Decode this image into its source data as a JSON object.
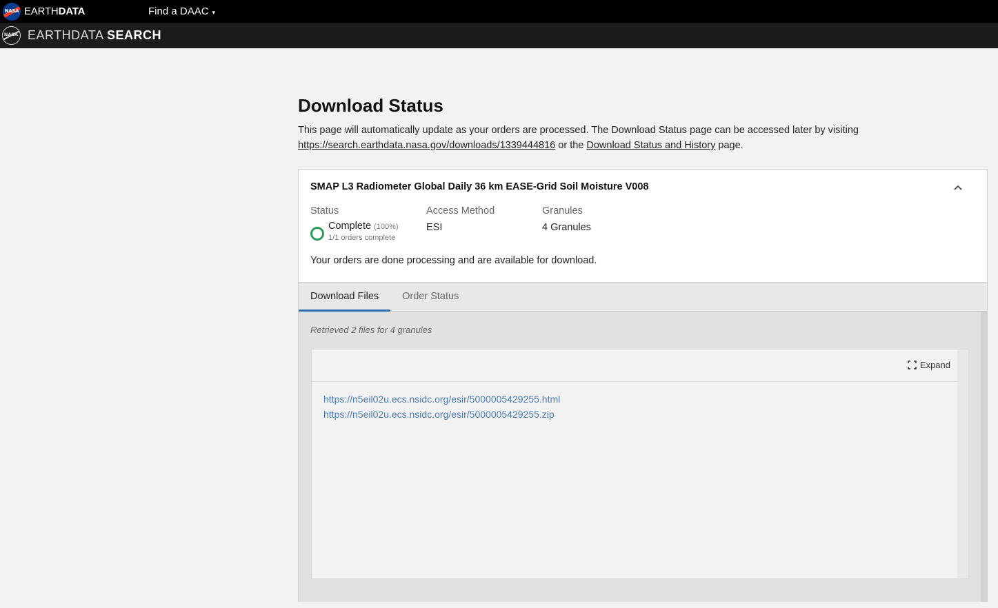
{
  "topbar": {
    "brand_light": "EARTH",
    "brand_bold": "DATA",
    "nasa_label": "NASA",
    "daac_menu": "Find a DAAC",
    "daac_caret": "▾"
  },
  "appbar": {
    "title_light": "EARTHDATA ",
    "title_bold": "SEARCH",
    "logo_label": "NASA"
  },
  "page": {
    "title": "Download Status",
    "intro_text": "This page will automatically update as your orders are processed. The Download Status page can be accessed later by visiting",
    "intro_link": "https://search.earthdata.nasa.gov/downloads/1339444816",
    "intro_mid": " or the ",
    "history_link": "Download Status and History",
    "intro_end": " page."
  },
  "order": {
    "title": "SMAP L3 Radiometer Global Daily 36 km EASE-Grid Soil Moisture V008",
    "status_label": "Status",
    "status_value": "Complete",
    "status_pct": "(100%)",
    "status_sub": "1/1 orders complete",
    "access_label": "Access Method",
    "access_value": "ESI",
    "granules_label": "Granules",
    "granules_value": "4 Granules",
    "done_message": "Your orders are done processing and are available for download.",
    "status_color": "#2a9d5c"
  },
  "tabs": [
    {
      "label": "Download Files",
      "active": true
    },
    {
      "label": "Order Status",
      "active": false
    }
  ],
  "files": {
    "retrieved": "Retrieved 2 files for 4 granules",
    "expand_label": "Expand",
    "links": [
      "https://n5eil02u.ecs.nsidc.org/esir/5000005429255.html",
      "https://n5eil02u.ecs.nsidc.org/esir/5000005429255.zip"
    ],
    "link_color": "#4a7bb0"
  }
}
